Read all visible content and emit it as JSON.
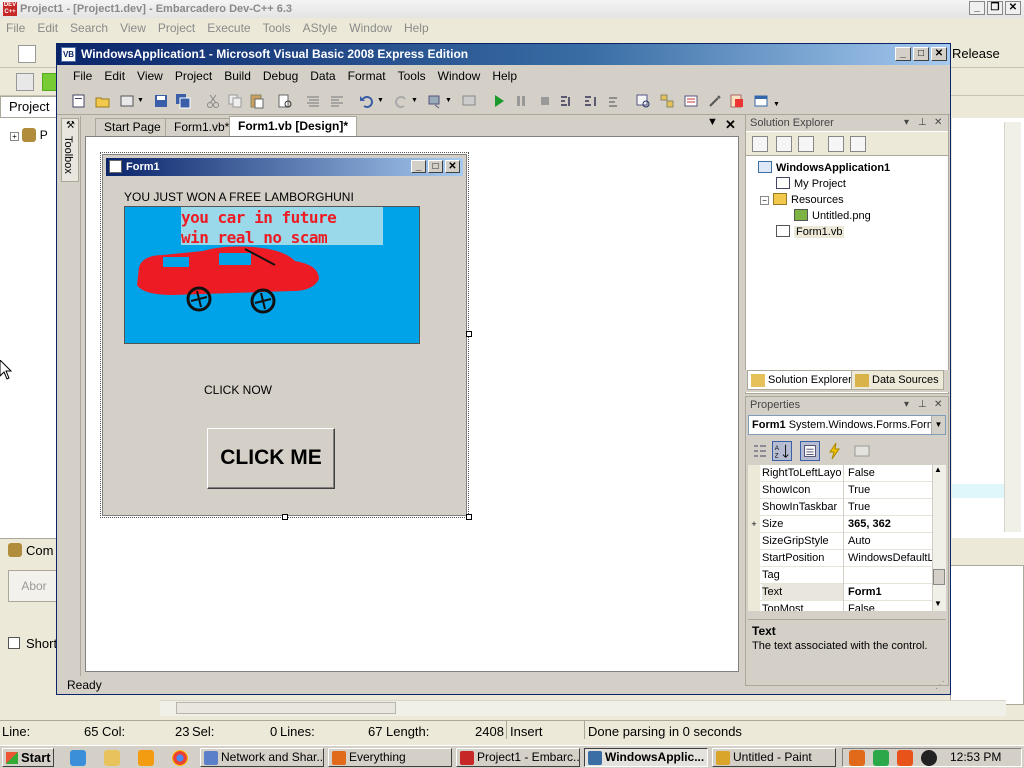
{
  "devcpp": {
    "title": "Project1 - [Project1.dev] - Embarcadero Dev-C++ 6.3",
    "logo_text": "DEV C++",
    "menu": [
      "File",
      "Edit",
      "Search",
      "View",
      "Project",
      "Execute",
      "Tools",
      "AStyle",
      "Window",
      "Help"
    ],
    "release_label": "Release",
    "project_tab": "Project",
    "tree_root": "P",
    "compiler_tab": "Com",
    "abort_label": "Abor",
    "short_label": "Short",
    "status": {
      "line_label": "Line:",
      "line_value": "65",
      "col_label": "Col:",
      "col_value": "23",
      "sel_label": "Sel:",
      "sel_value": "0",
      "lines_label": "Lines:",
      "lines_value": "67",
      "length_label": "Length:",
      "length_value": "2408",
      "mode": "Insert",
      "message": "Done parsing in 0 seconds"
    }
  },
  "vb": {
    "title": "WindowsApplication1 - Microsoft Visual Basic 2008 Express Edition",
    "icon_text": "VB",
    "menu": [
      "File",
      "Edit",
      "View",
      "Project",
      "Build",
      "Debug",
      "Data",
      "Format",
      "Tools",
      "Window",
      "Help"
    ],
    "toolbox_label": "Toolbox",
    "tabs": [
      "Start Page",
      "Form1.vb*",
      "Form1.vb [Design]*"
    ],
    "active_tab": 2,
    "status": "Ready"
  },
  "form1": {
    "title": "Form1",
    "label_won": "YOU JUST WON A FREE LAMBORGHUNI",
    "picture_text_1": "you car in future",
    "picture_text_2": "win real no scam",
    "label_click_now": "CLICK NOW",
    "button_label": "CLICK ME"
  },
  "solution_explorer": {
    "header": "Solution Explorer",
    "items": [
      {
        "label": "WindowsApplication1",
        "level": 0,
        "icon": "vb-project-icon"
      },
      {
        "label": "My Project",
        "level": 1,
        "icon": "my-project-icon"
      },
      {
        "label": "Resources",
        "level": 1,
        "icon": "folder-icon"
      },
      {
        "label": "Untitled.png",
        "level": 2,
        "icon": "image-file-icon"
      },
      {
        "label": "Form1.vb",
        "level": 1,
        "icon": "form-file-icon"
      }
    ],
    "bottom_tabs": [
      "Solution Explorer",
      "Data Sources"
    ]
  },
  "properties": {
    "header": "Properties",
    "object_name": "Form1",
    "object_type": "System.Windows.Forms.Form",
    "rows": [
      {
        "name": "RightToLeftLayo",
        "value": "False"
      },
      {
        "name": "ShowIcon",
        "value": "True"
      },
      {
        "name": "ShowInTaskbar",
        "value": "True"
      },
      {
        "name": "Size",
        "value": "365, 362",
        "expand": "+",
        "bold": true
      },
      {
        "name": "SizeGripStyle",
        "value": "Auto"
      },
      {
        "name": "StartPosition",
        "value": "WindowsDefaultLo"
      },
      {
        "name": "Tag",
        "value": ""
      },
      {
        "name": "Text",
        "value": "Form1",
        "bold": true,
        "selected": true
      },
      {
        "name": "TopMost",
        "value": "False"
      }
    ],
    "desc_title": "Text",
    "desc_text": "The text associated with the control."
  },
  "taskbar": {
    "start_label": "Start",
    "tasks": [
      {
        "label": "Network and Shar...",
        "icon_color": "#5b7fc8",
        "active": false
      },
      {
        "label": "Everything",
        "icon_color": "#e06a1a",
        "active": false
      },
      {
        "label": "Project1 - Embarc...",
        "icon_color": "#c62828",
        "active": false
      },
      {
        "label": "WindowsApplic...",
        "icon_color": "#3a6ea5",
        "active": true
      },
      {
        "label": "Untitled - Paint",
        "icon_color": "#d9a52b",
        "active": false
      }
    ],
    "clock": "12:53 PM"
  },
  "colors": {
    "vb_title_start": "#0a246a",
    "picture_bg": "#00a2e8",
    "car_red": "#ed1c24",
    "text_box_bg": "#99d9ea"
  }
}
